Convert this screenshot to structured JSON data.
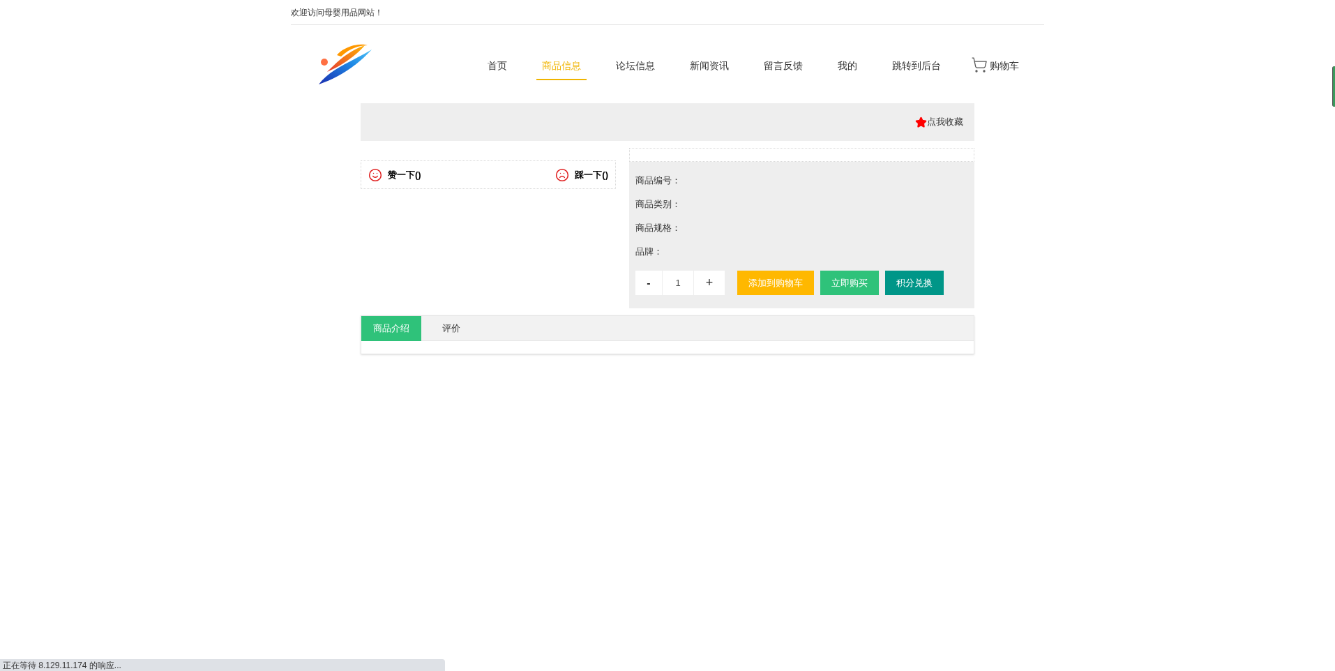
{
  "topbar": {
    "welcome": "欢迎访问母婴用品网站！"
  },
  "nav": {
    "items": [
      {
        "label": "首页",
        "selected": false
      },
      {
        "label": "商品信息",
        "selected": true
      },
      {
        "label": "论坛信息",
        "selected": false
      },
      {
        "label": "新闻资讯",
        "selected": false
      },
      {
        "label": "留言反馈",
        "selected": false
      },
      {
        "label": "我的",
        "selected": false
      },
      {
        "label": "跳转到后台",
        "selected": false
      }
    ],
    "cart": "购物车"
  },
  "favorite": "点我收藏",
  "votes": [
    {
      "kind": "like",
      "label": "赞一下()"
    },
    {
      "kind": "dislike",
      "label": "踩一下()"
    }
  ],
  "details": [
    {
      "label": "商品编号："
    },
    {
      "label": "商品类别："
    },
    {
      "label": "商品规格："
    },
    {
      "label": "品牌："
    }
  ],
  "quantity": {
    "minus": "-",
    "value": "1",
    "plus": "+"
  },
  "actions": [
    {
      "label": "添加到购物车",
      "color": "#ffb800"
    },
    {
      "label": "立即购买",
      "color": "#2fc27a"
    },
    {
      "label": "积分兑换",
      "color": "#009688"
    }
  ],
  "tabs": [
    {
      "label": "商品介绍",
      "selected": true
    },
    {
      "label": "评价",
      "selected": false
    }
  ],
  "status_bar": "正在等待 8.129.11.174 的响应..."
}
